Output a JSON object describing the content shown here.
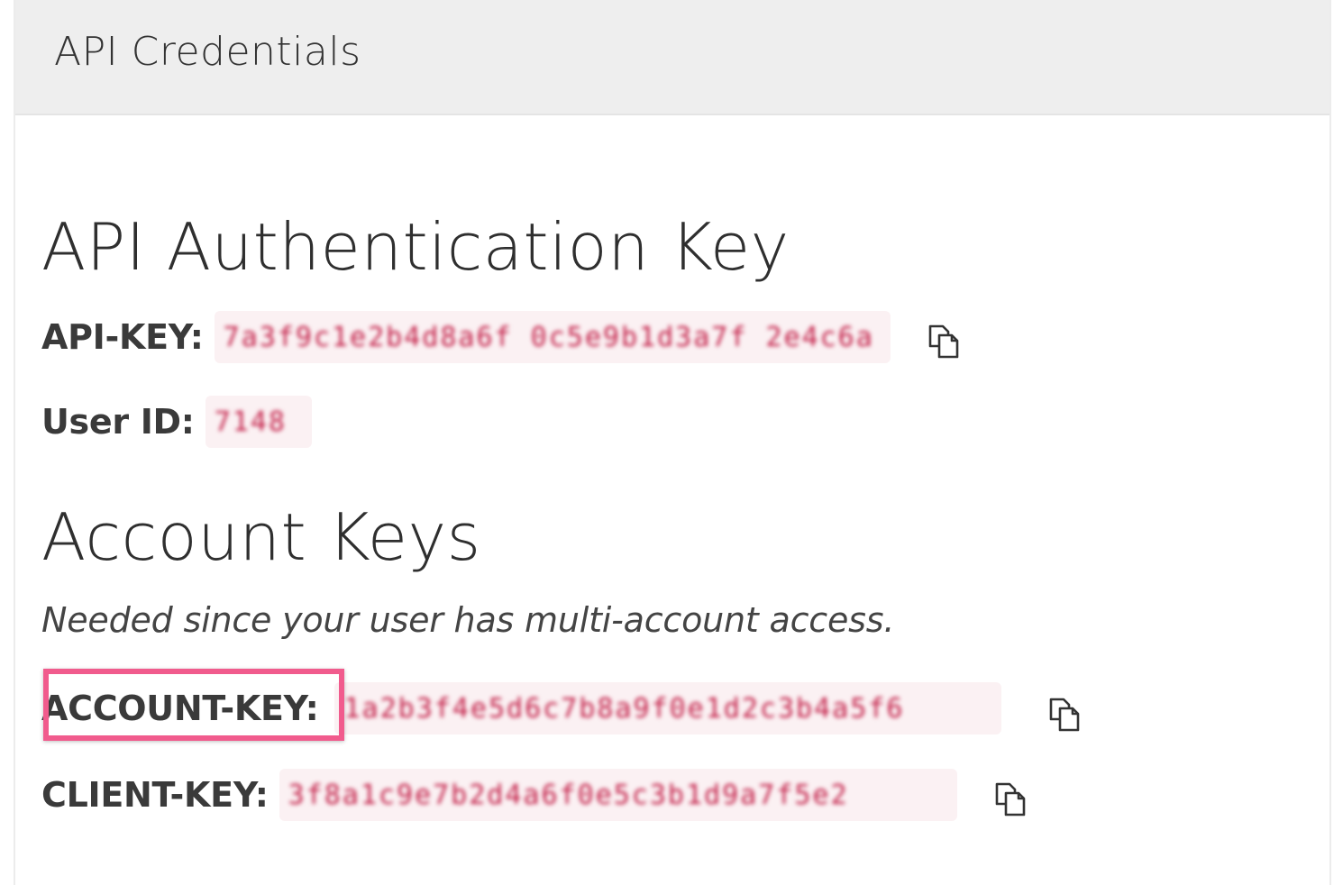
{
  "panel": {
    "title": "API Credentials"
  },
  "auth_section": {
    "heading": "API Authentication Key",
    "api_key": {
      "label": "API-KEY:",
      "value": "7a3f9c1e2b4d8a6f 0c5e9b1d3a7f 2e4c6a",
      "copy_icon": "copy-icon"
    },
    "user_id": {
      "label": "User ID:",
      "value": "7148"
    }
  },
  "account_section": {
    "heading": "Account Keys",
    "note": "Needed since your user has multi-account access.",
    "account_key": {
      "label": "ACCOUNT-KEY:",
      "value": "1a2b3f4e5d6c7b8a9f0e1d2c3b4a5f6",
      "copy_icon": "copy-icon"
    },
    "client_key": {
      "label": "CLIENT-KEY:",
      "value": "3f8a1c9e7b2d4a6f0e5c3b1d9a7f5e2",
      "copy_icon": "copy-icon"
    }
  },
  "colors": {
    "header_bg": "#eeeeee",
    "code_bg": "#fbf1f3",
    "code_text": "#c21d46",
    "highlight_border": "#f15b8d"
  }
}
